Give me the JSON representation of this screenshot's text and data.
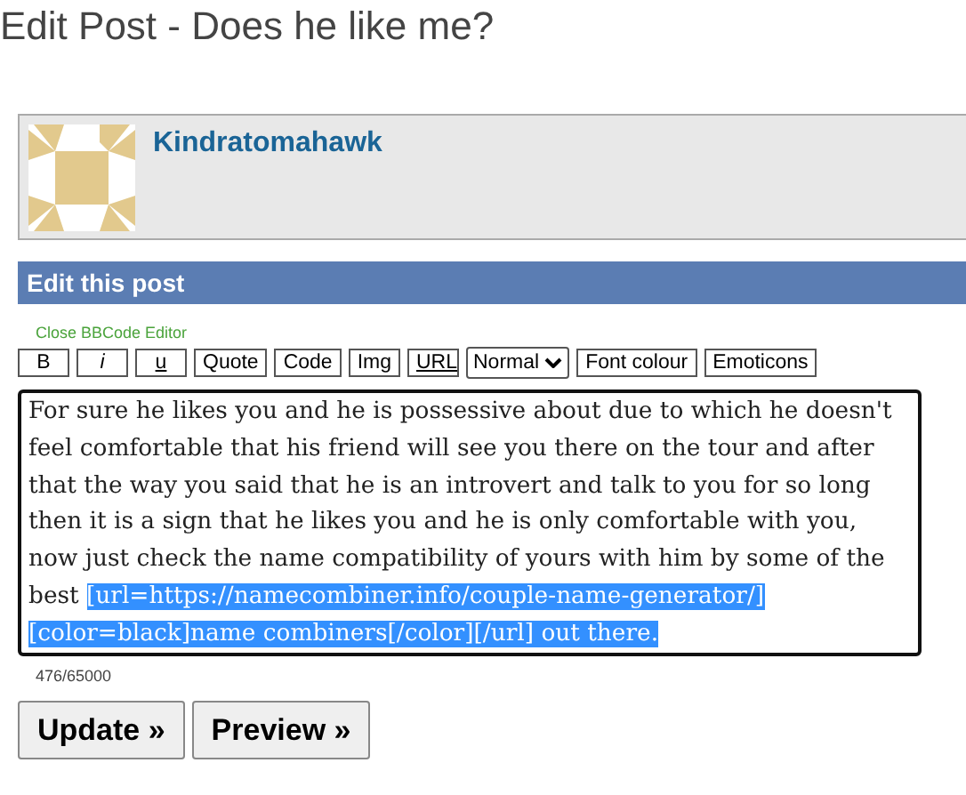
{
  "page_title": "Edit Post - Does he like me?",
  "user": {
    "name": "Kindratomahawk"
  },
  "section_header": "Edit this post",
  "editor_toggle": "Close BBCode Editor",
  "toolbar": [
    {
      "kind": "bold",
      "label": "B"
    },
    {
      "kind": "italic",
      "label": "i"
    },
    {
      "kind": "underline",
      "label": "u"
    },
    {
      "kind": "plain",
      "label": "Quote"
    },
    {
      "kind": "plain",
      "label": "Code"
    },
    {
      "kind": "plain",
      "label": "Img"
    },
    {
      "kind": "underline",
      "label": "URL"
    },
    {
      "kind": "select",
      "label": "Normal"
    },
    {
      "kind": "plain",
      "label": "Font colour"
    },
    {
      "kind": "plain",
      "label": "Emoticons"
    }
  ],
  "post_body": {
    "text": "For sure he likes you and he is possessive about due to which he doesn't feel comfortable that his friend will see you there on the tour and after that the way you said that he is an introvert and talk to you for so long then it is a sign that he likes you and he is only comfortable with you, now just check the name compatibility of yours with him by some of the best ",
    "selected_text": "[url=https://namecombiner.info/couple-name-generator/][color=black]name combiners[/color][/url] out there."
  },
  "char_count": "476/65000",
  "actions": [
    "Update »",
    "Preview »"
  ]
}
